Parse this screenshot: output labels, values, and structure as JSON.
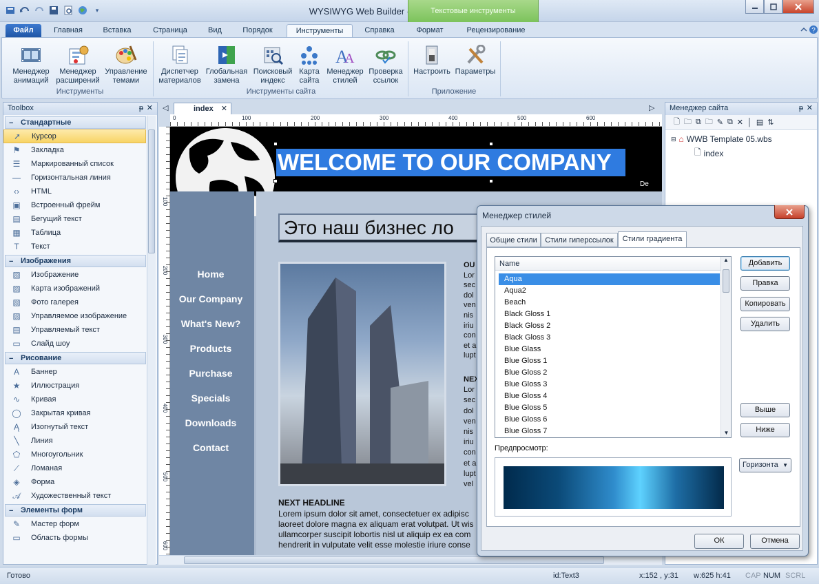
{
  "window": {
    "title": "WYSIWYG Web Builder - [WWB Template 05.wbs]",
    "context_tab": "Текстовые инструменты"
  },
  "ribbon": {
    "tabs": [
      "Файл",
      "Главная",
      "Вставка",
      "Страница",
      "Вид",
      "Порядок",
      "Инструменты",
      "Справка",
      "Формат",
      "Рецензирование"
    ],
    "groups": [
      {
        "label": "Инструменты",
        "buttons": [
          {
            "line1": "Менеджер",
            "line2": "анимаций",
            "icon": "film-icon"
          },
          {
            "line1": "Менеджер",
            "line2": "расширений",
            "icon": "puzzle-icon"
          },
          {
            "line1": "Управление",
            "line2": "темами",
            "icon": "palette-icon"
          }
        ]
      },
      {
        "label": "Инструменты сайта",
        "buttons": [
          {
            "line1": "Диспетчер",
            "line2": "материалов",
            "icon": "documents-icon"
          },
          {
            "line1": "Глобальная",
            "line2": "замена",
            "icon": "replace-icon"
          },
          {
            "line1": "Поисковый",
            "line2": "индекс",
            "icon": "search-index-icon"
          },
          {
            "line1": "Карта",
            "line2": "сайта",
            "icon": "sitemap-icon"
          },
          {
            "line1": "Менеджер",
            "line2": "стилей",
            "icon": "styles-icon"
          },
          {
            "line1": "Проверка",
            "line2": "ссылок",
            "icon": "link-check-icon"
          }
        ]
      },
      {
        "label": "Приложение",
        "buttons": [
          {
            "line1": "Настроить",
            "line2": "",
            "icon": "switch-icon"
          },
          {
            "line1": "Параметры",
            "line2": "",
            "icon": "tools-icon"
          }
        ]
      }
    ]
  },
  "toolbox": {
    "title": "Toolbox",
    "groups": [
      {
        "label": "Стандартные",
        "items": [
          {
            "label": "Курсор",
            "icon": "cursor-icon"
          },
          {
            "label": "Закладка",
            "icon": "bookmark-icon"
          },
          {
            "label": "Маркированный список",
            "icon": "bullet-list-icon"
          },
          {
            "label": "Горизонтальная линия",
            "icon": "hline-icon"
          },
          {
            "label": "HTML",
            "icon": "html-icon"
          },
          {
            "label": "Встроенный фрейм",
            "icon": "iframe-icon"
          },
          {
            "label": "Бегущий текст",
            "icon": "marquee-icon"
          },
          {
            "label": "Таблица",
            "icon": "table-icon"
          },
          {
            "label": "Текст",
            "icon": "text-icon"
          }
        ]
      },
      {
        "label": "Изображения",
        "items": [
          {
            "label": "Изображение",
            "icon": "image-icon"
          },
          {
            "label": "Карта изображений",
            "icon": "image-map-icon"
          },
          {
            "label": "Фото галерея",
            "icon": "gallery-icon"
          },
          {
            "label": "Управляемое изображение",
            "icon": "managed-image-icon"
          },
          {
            "label": "Управляемый текст",
            "icon": "managed-text-icon"
          },
          {
            "label": "Слайд шоу",
            "icon": "slideshow-icon"
          }
        ]
      },
      {
        "label": "Рисование",
        "items": [
          {
            "label": "Баннер",
            "icon": "banner-icon"
          },
          {
            "label": "Иллюстрация",
            "icon": "star-icon"
          },
          {
            "label": "Кривая",
            "icon": "curve-icon"
          },
          {
            "label": "Закрытая кривая",
            "icon": "closed-curve-icon"
          },
          {
            "label": "Изогнутый текст",
            "icon": "curved-text-icon"
          },
          {
            "label": "Линия",
            "icon": "line-icon"
          },
          {
            "label": "Многоугольник",
            "icon": "polygon-icon"
          },
          {
            "label": "Ломаная",
            "icon": "polyline-icon"
          },
          {
            "label": "Форма",
            "icon": "shape-icon"
          },
          {
            "label": "Художественный текст",
            "icon": "art-text-icon"
          }
        ]
      },
      {
        "label": "Элементы форм",
        "items": [
          {
            "label": "Мастер форм",
            "icon": "form-wizard-icon"
          },
          {
            "label": "Область формы",
            "icon": "form-area-icon"
          }
        ]
      }
    ]
  },
  "editor": {
    "tab": "index",
    "ruler_h": [
      "0",
      "100",
      "200",
      "300",
      "400",
      "500",
      "600"
    ],
    "ruler_v": [
      "100",
      "200",
      "300",
      "400",
      "500",
      "600"
    ],
    "page": {
      "banner": "WELCOME TO OUR COMPANY",
      "banner_tail": "De",
      "heading": "Это наш бизнес ло",
      "nav": [
        "Home",
        "Our Company",
        "What's New?",
        "Products",
        "Purchase",
        "Specials",
        "Downloads",
        "Contact"
      ],
      "col_text": [
        [
          "OU",
          "Lor",
          "sec",
          "dol",
          "ven",
          "nis",
          "iriu",
          "con",
          "et a",
          "lupt"
        ],
        [
          "NEX",
          "Lor",
          "sec",
          "dol",
          "ven",
          "nis",
          "iriu",
          "con",
          "et a",
          "lupt",
          "vel"
        ]
      ],
      "headline": "NEXT HEADLINE",
      "body": [
        "Lorem ipsum dolor sit amet, consectetuer ex adipisc",
        "laoreet dolore magna ex aliquam erat volutpat. Ut wis",
        "ullamcorper suscipit lobortis nisl ut aliquip ex ea com",
        "hendrerit in vulputate velit esse molestie iriure conse"
      ]
    }
  },
  "site_manager": {
    "title": "Менеджер сайта",
    "root": "WWB Template 05.wbs",
    "child": "index"
  },
  "dialog": {
    "title": "Менеджер стилей",
    "tabs": [
      "Общие стили",
      "Стили гиперссылок",
      "Стили градиента"
    ],
    "column": "Name",
    "items": [
      "Aqua",
      "Aqua2",
      "Beach",
      "Black Gloss 1",
      "Black Gloss 2",
      "Black Gloss 3",
      "Blue Glass",
      "Blue Gloss 1",
      "Blue Gloss 2",
      "Blue Gloss 3",
      "Blue Gloss 4",
      "Blue Gloss 5",
      "Blue Gloss 6",
      "Blue Gloss 7"
    ],
    "buttons": {
      "add": "Добавить",
      "edit": "Правка",
      "copy": "Копировать",
      "delete": "Удалить",
      "up": "Выше",
      "down": "Ниже",
      "ok": "ОК",
      "cancel": "Отмена"
    },
    "preview_label": "Предпросмотр:",
    "direction": "Горизонта"
  },
  "status": {
    "ready": "Готово",
    "id": "id:Text3",
    "xy": "x:152 , y:31",
    "wh": "w:625 h:41",
    "cap": "CAP",
    "num": "NUM",
    "scrl": "SCRL"
  },
  "colors": {
    "accent": "#3a8ee6",
    "banner_bg": "#000000",
    "selection": "#2f7be0",
    "page_bg": "#7f96b4",
    "nav_bg": "#6f86a4"
  }
}
